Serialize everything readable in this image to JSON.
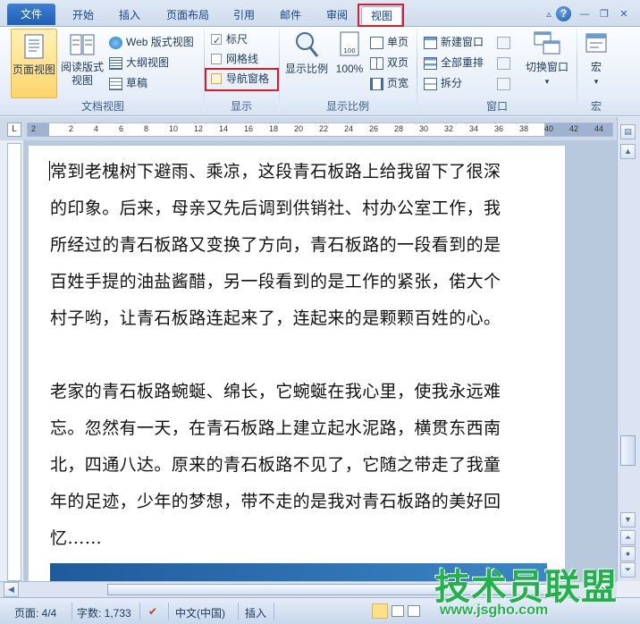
{
  "tabs": [
    {
      "label": "文件"
    },
    {
      "label": "开始"
    },
    {
      "label": "插入"
    },
    {
      "label": "页面布局"
    },
    {
      "label": "引用"
    },
    {
      "label": "邮件"
    },
    {
      "label": "审阅"
    },
    {
      "label": "视图"
    }
  ],
  "ribbon": {
    "document_views": {
      "label": "文档视图",
      "page_view": "页面视图",
      "reading_view_1": "阅读版式",
      "reading_view_2": "视图",
      "web_view": "Web 版式视图",
      "outline_view": "大纲视图",
      "draft_view": "草稿"
    },
    "show": {
      "label": "显示",
      "ruler": "标尺",
      "ruler_checked": true,
      "gridlines": "网格线",
      "gridlines_checked": false,
      "nav_pane": "导航窗格",
      "nav_pane_checked": false
    },
    "zoom": {
      "label": "显示比例",
      "zoom_button": "显示比例",
      "hundred": "100%",
      "one_page": "单页",
      "two_pages": "双页",
      "page_width": "页宽"
    },
    "window": {
      "label": "窗口",
      "new_window": "新建窗口",
      "arrange_all": "全部重排",
      "split": "拆分",
      "switch_windows": "切换窗口"
    },
    "macros": {
      "label": "宏",
      "button": "宏"
    }
  },
  "ruler_numbers": [
    "2",
    "2",
    "4",
    "6",
    "8",
    "10",
    "12",
    "14",
    "16",
    "18",
    "20",
    "22",
    "24",
    "26",
    "28",
    "30",
    "32",
    "34",
    "36",
    "38",
    "40",
    "42",
    "44"
  ],
  "document": {
    "lines": [
      "常到老槐树下避雨、乘凉，这段青石板路上给我留下了很深",
      "的印象。后来，母亲又先后调到供销社、村办公室工作，我",
      "所经过的青石板路又变换了方向，青石板路的一段看到的是",
      "百姓手提的油盐酱醋，另一段看到的是工作的紧张，偌大个",
      "村子哟，让青石板路连起来了，连起来的是颗颗百姓的心。",
      "",
      "老家的青石板路蜿蜒、绵长，它蜿蜒在我心里，使我永远难",
      "忘。忽然有一天，在青石板路上建立起水泥路，横贯东西南",
      "北，四通八达。原来的青石板路不见了，它随之带走了我童",
      "年的足迹，少年的梦想，带不走的是我对青石板路的美好回",
      "忆……"
    ]
  },
  "status": {
    "page": "页面: 4/4",
    "words": "字数: 1,733",
    "language": "中文(中国)",
    "insert": "插入"
  },
  "watermark": {
    "text": "技术员联盟",
    "url": "www.jsgho.com"
  },
  "colors": {
    "highlight_box": "#d81e2e",
    "file_tab": "#2a6bc3",
    "watermark": "#22b24c"
  }
}
